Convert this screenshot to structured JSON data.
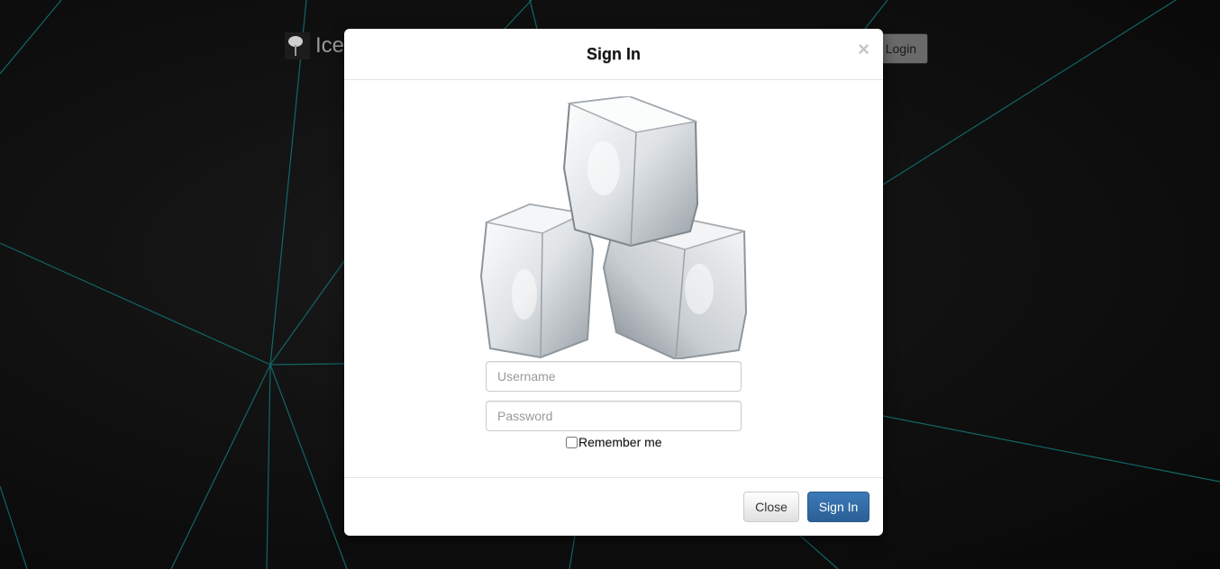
{
  "brand": {
    "name": "Ice",
    "icon": "ice-cream-icon"
  },
  "nav": {
    "login_label": "Login"
  },
  "modal": {
    "title": "Sign In",
    "close_symbol": "×",
    "image": "ice-cubes-image",
    "username_placeholder": "Username",
    "password_placeholder": "Password",
    "remember_label": "Remember me",
    "close_button": "Close",
    "signin_button": "Sign In"
  },
  "colors": {
    "background": "#141414",
    "accent_lines": "#1aa3a3",
    "primary_button": "#337ab7"
  }
}
